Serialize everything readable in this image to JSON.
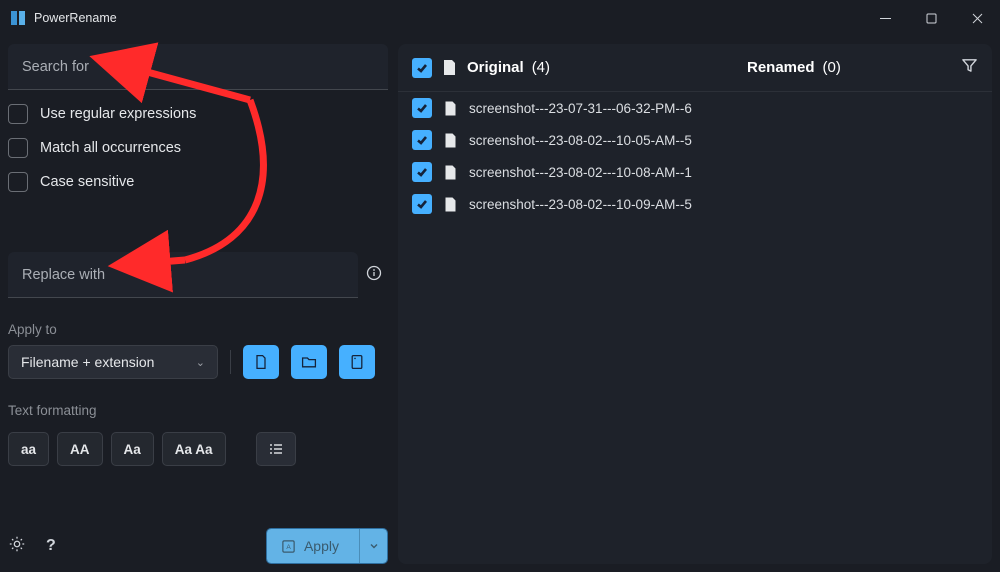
{
  "window": {
    "title": "PowerRename"
  },
  "search": {
    "placeholder": "Search for"
  },
  "options": {
    "regex": "Use regular expressions",
    "match_all": "Match all occurrences",
    "case_sensitive": "Case sensitive"
  },
  "replace": {
    "placeholder": "Replace with"
  },
  "apply_to": {
    "label": "Apply to",
    "selected": "Filename + extension"
  },
  "formatting": {
    "label": "Text formatting",
    "lower": "aa",
    "upper": "AA",
    "title": "Aa",
    "titlewords": "Aa Aa"
  },
  "apply_btn": "Apply",
  "columns": {
    "original": "Original",
    "original_count": "(4)",
    "renamed": "Renamed",
    "renamed_count": "(0)"
  },
  "files": [
    {
      "name": "screenshot---23-07-31---06-32-PM--6"
    },
    {
      "name": "screenshot---23-08-02---10-05-AM--5"
    },
    {
      "name": "screenshot---23-08-02---10-08-AM--1"
    },
    {
      "name": "screenshot---23-08-02---10-09-AM--5"
    }
  ]
}
